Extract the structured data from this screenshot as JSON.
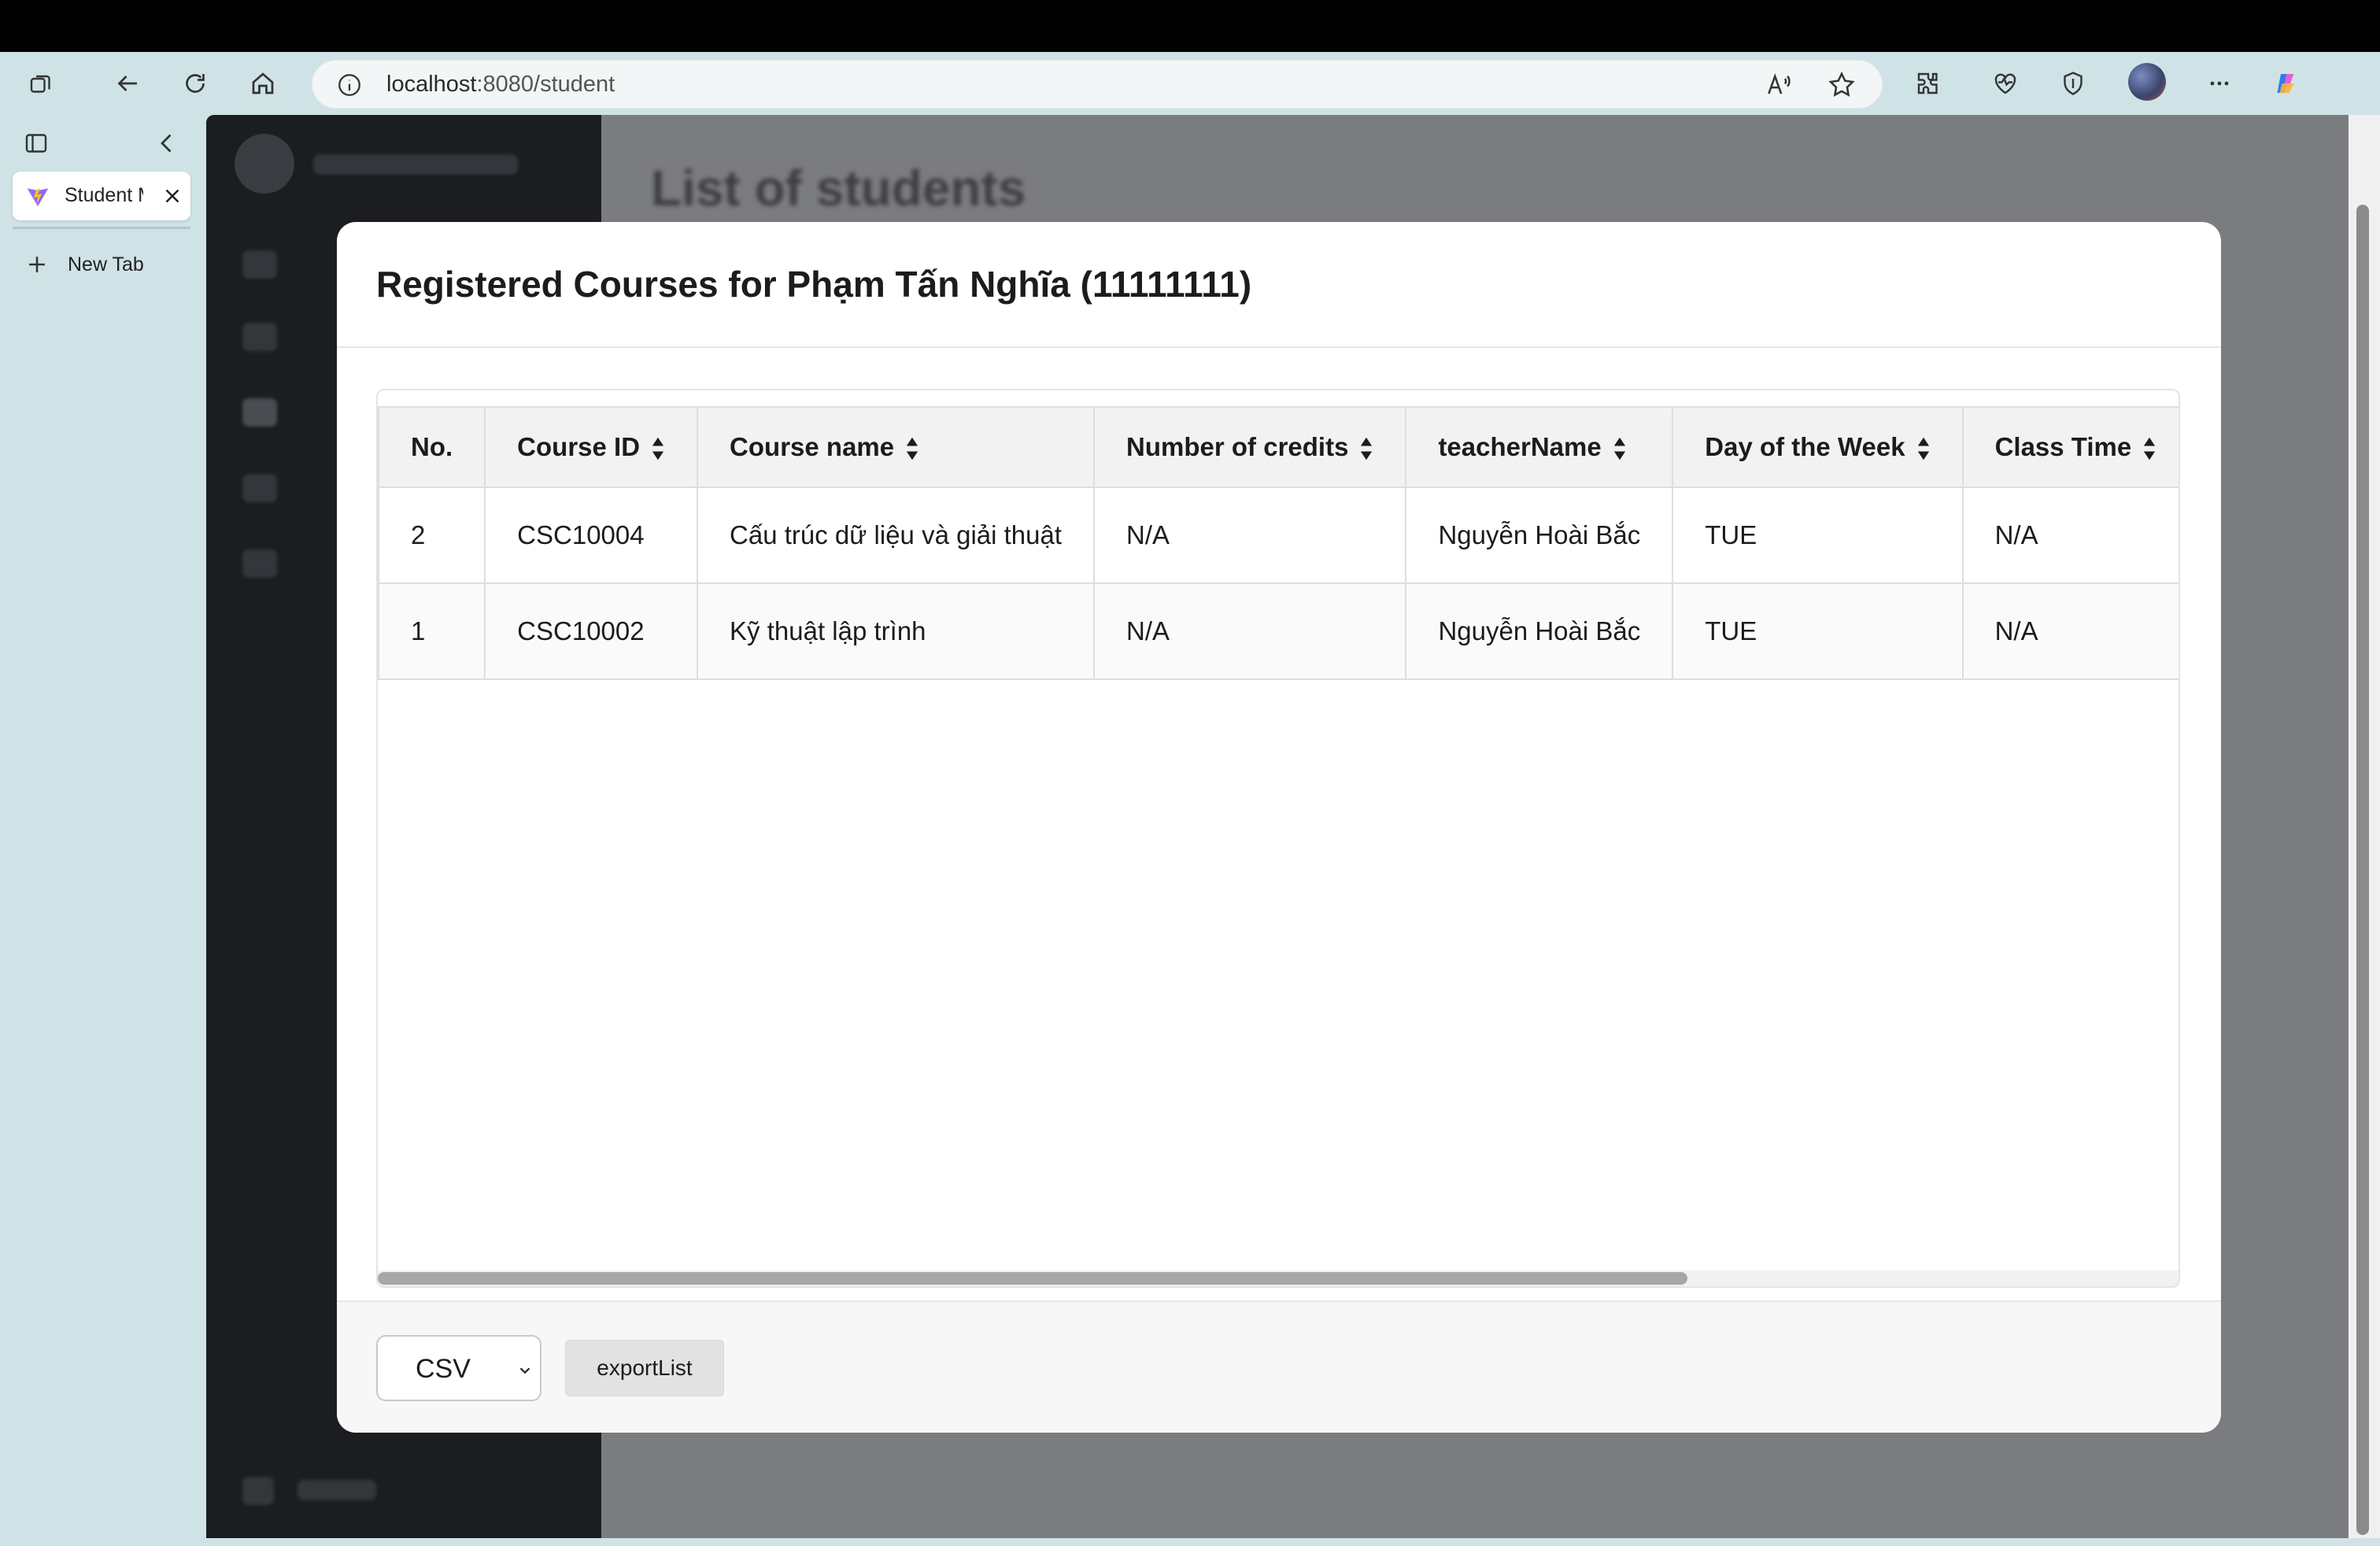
{
  "browser": {
    "url_host": "localhost",
    "url_path": ":8080/student",
    "tab_label": "Student Management",
    "new_tab_label": "New Tab"
  },
  "modal": {
    "title": "Registered Courses for Phạm Tấn Nghĩa (11111111)",
    "columns": [
      "No.",
      "Course ID",
      "Course name",
      "Number of credits",
      "teacherName",
      "Day of the Week",
      "Class Time"
    ],
    "rows": [
      [
        "2",
        "CSC10004",
        "Cấu trúc dữ liệu và giải thuật",
        "N/A",
        "Nguyễn Hoài Bắc",
        "TUE",
        "N/A"
      ],
      [
        "1",
        "CSC10002",
        "Kỹ thuật lập trình",
        "N/A",
        "Nguyễn Hoài Bắc",
        "TUE",
        "N/A"
      ]
    ],
    "format_select": "CSV",
    "export_label": "exportList"
  },
  "background_app": {
    "heading": "List of students"
  },
  "colors": {
    "toolbar_bg": "#cfe3e6",
    "overlay": "#7b7c80",
    "app_sidebar": "#1b1d21"
  }
}
